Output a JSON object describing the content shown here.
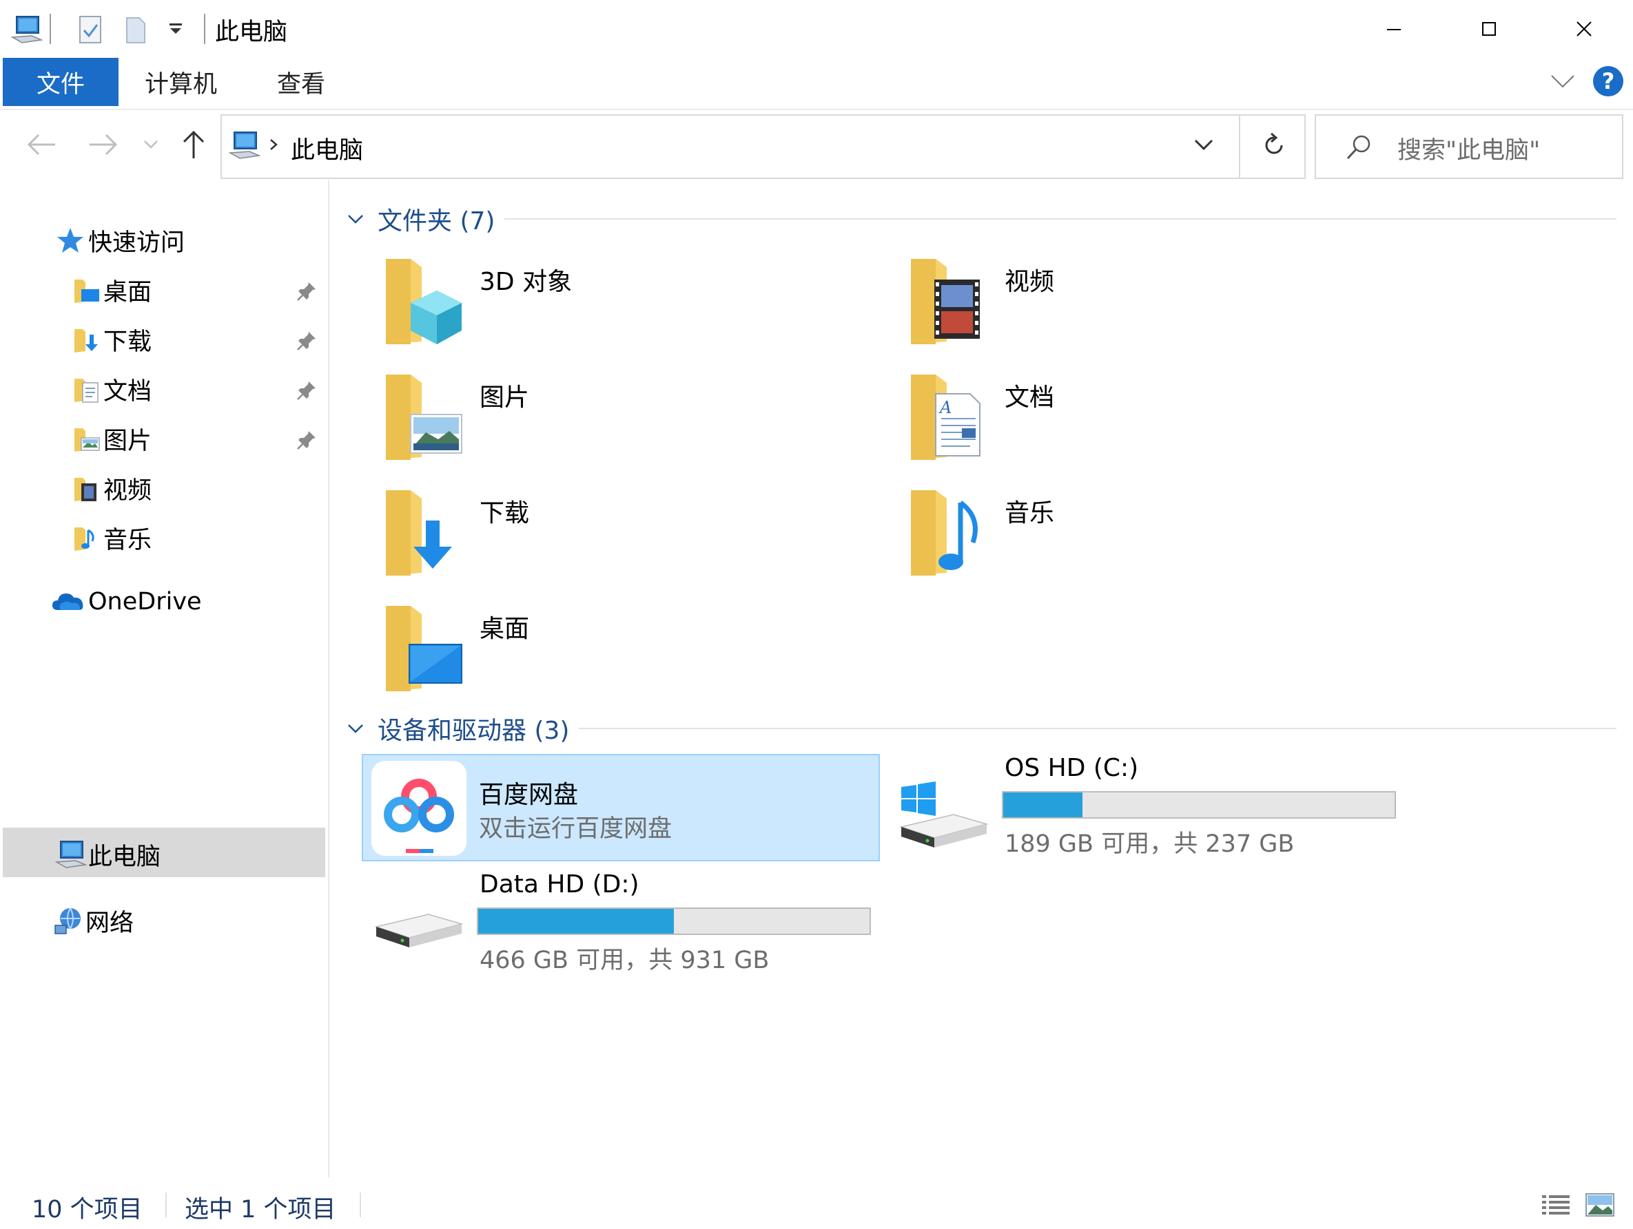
{
  "window": {
    "title": "此电脑",
    "controls": [
      "minimize-icon",
      "maximize-icon",
      "close-icon"
    ]
  },
  "ribbon": {
    "tabs": [
      {
        "label": "文件",
        "active": true
      },
      {
        "label": "计算机",
        "active": false
      },
      {
        "label": "查看",
        "active": false
      }
    ],
    "help": "?"
  },
  "address": {
    "path": "此电脑",
    "search_placeholder": "搜索\"此电脑\""
  },
  "nav": {
    "quick_access": "快速访问",
    "quick_items": [
      {
        "label": "桌面",
        "pinned": true
      },
      {
        "label": "下载",
        "pinned": true
      },
      {
        "label": "文档",
        "pinned": true
      },
      {
        "label": "图片",
        "pinned": true
      },
      {
        "label": "视频",
        "pinned": false
      },
      {
        "label": "音乐",
        "pinned": false
      }
    ],
    "onedrive": "OneDrive",
    "this_pc": "此电脑",
    "network": "网络"
  },
  "content": {
    "folders_header": "文件夹 (7)",
    "folders": [
      {
        "label": "3D 对象",
        "icon": "3d-objects-icon"
      },
      {
        "label": "视频",
        "icon": "video-icon"
      },
      {
        "label": "图片",
        "icon": "picture-icon"
      },
      {
        "label": "文档",
        "icon": "document-icon"
      },
      {
        "label": "下载",
        "icon": "download-icon"
      },
      {
        "label": "音乐",
        "icon": "music-icon"
      },
      {
        "label": "桌面",
        "icon": "desktop-icon"
      }
    ],
    "devices_header": "设备和驱动器 (3)",
    "baidu": {
      "name": "百度网盘",
      "sub": "双击运行百度网盘"
    },
    "drive_c": {
      "name": "OS HD (C:)",
      "space": "189 GB 可用，共 237 GB",
      "used_fraction": 0.2025
    },
    "drive_d": {
      "name": "Data HD (D:)",
      "space": "466 GB 可用，共 931 GB",
      "used_fraction": 0.4995
    }
  },
  "status": {
    "count": "10 个项目",
    "selected": "选中 1 个项目"
  },
  "colors": {
    "accent": "#1a6cc6",
    "selection": "#cce8ff",
    "bar": "#26a0da",
    "header_text": "#1e4e8c"
  }
}
